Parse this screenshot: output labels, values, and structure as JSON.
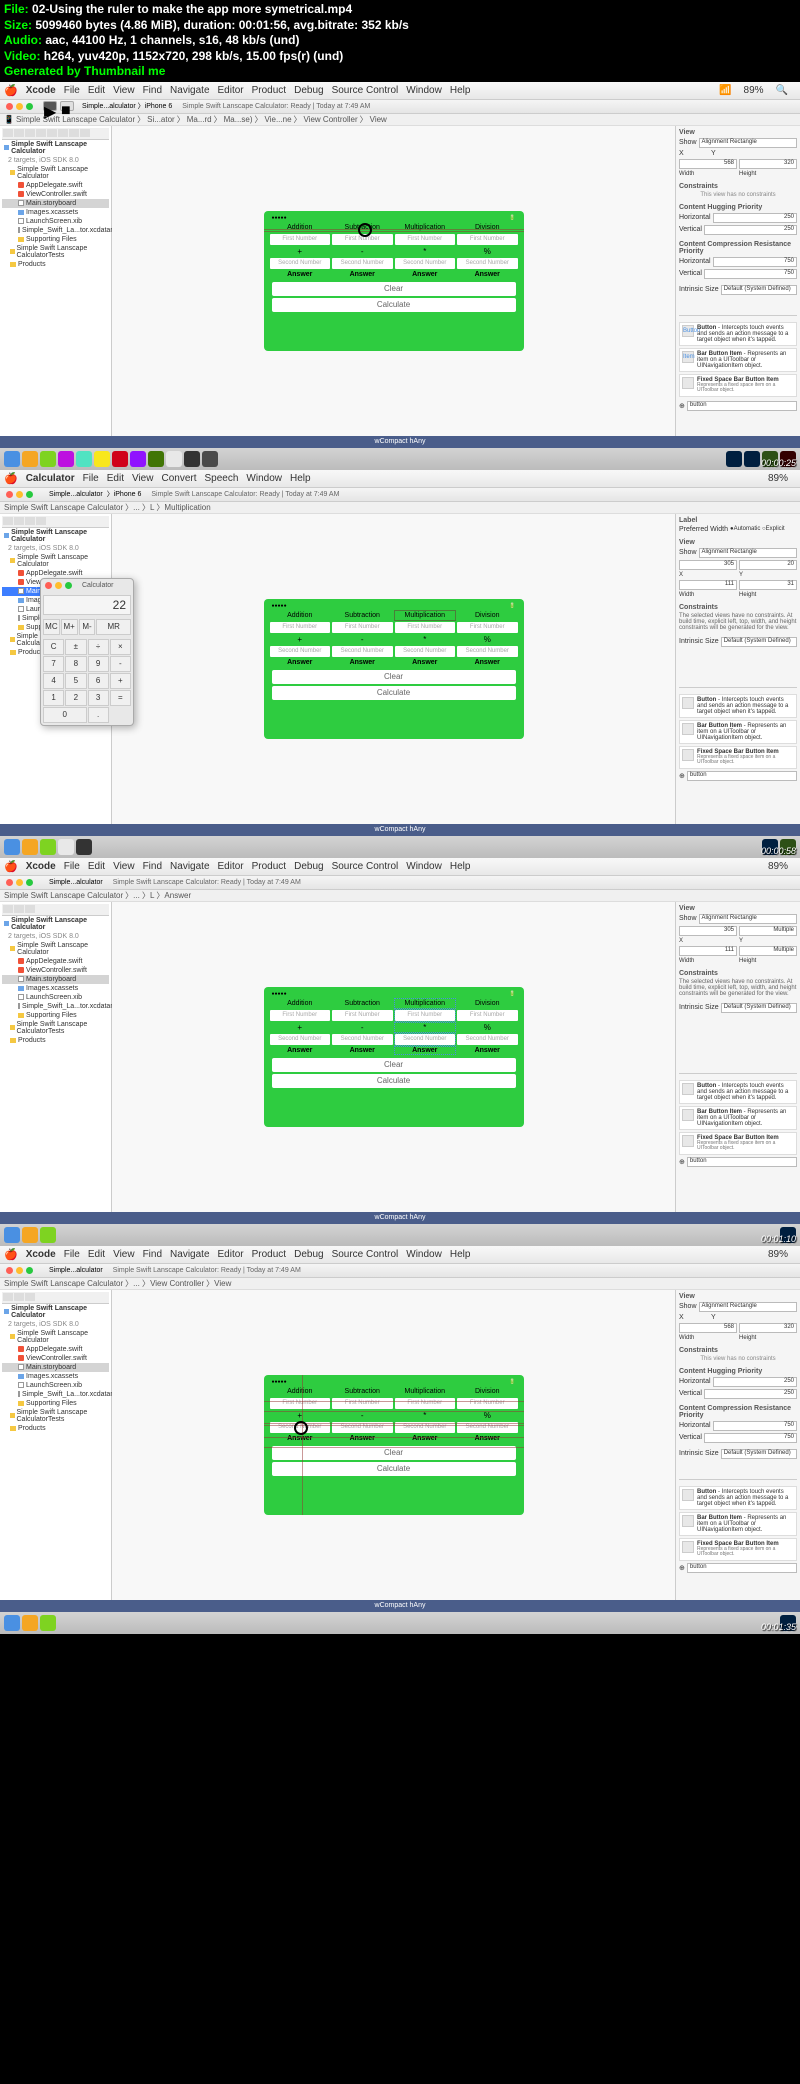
{
  "header": {
    "file": "02-Using the ruler to make the app more symetrical.mp4",
    "size": "5099460 bytes (4.86 MiB), duration: 00:01:56, avg.bitrate: 352 kb/s",
    "audio": "aac, 44100 Hz, 1 channels, s16, 48 kb/s (und)",
    "video": "h264, yuv420p, 1152x720, 298 kb/s, 15.00 fps(r) (und)",
    "gen": "Generated by Thumbnail me"
  },
  "menubar": {
    "app": "Xcode",
    "items": [
      "File",
      "Edit",
      "View",
      "Find",
      "Navigate",
      "Editor",
      "Product",
      "Debug",
      "Source Control",
      "Window",
      "Help"
    ],
    "calc_items": [
      "File",
      "Edit",
      "View",
      "Convert",
      "Speech",
      "Window",
      "Help"
    ],
    "calc_app": "Calculator",
    "battery": "89%"
  },
  "breadcrumb": {
    "scheme": "Simple...alculator",
    "device": "iPhone 6",
    "status": "Simple Swift Lanscape Calculator: Ready | Today at 7:49 AM",
    "path": [
      "Simple Swift Lanscape Calculator",
      "Si...ator",
      "Ma...rd",
      "Ma...se)",
      "Vie...ne",
      "View Controller",
      "View"
    ]
  },
  "navigator": {
    "project": "Simple Swift Lanscape Calculator",
    "targets": "2 targets, iOS SDK 8.0",
    "items": [
      "Simple Swift Lanscape Calculator",
      "AppDelegate.swift",
      "ViewController.swift",
      "Main.storyboard",
      "Images.xcassets",
      "LaunchScreen.xib",
      "Simple_Swift_La...tor.xcdatamodeld",
      "Supporting Files",
      "Simple Swift Lanscape CalculatorTests",
      "Products"
    ]
  },
  "phone": {
    "cols": [
      "Addition",
      "Subtraction",
      "Multiplication",
      "Division"
    ],
    "ph1": "First Number",
    "ops": [
      "+",
      "-",
      "*",
      "%"
    ],
    "ph2": "Second Number",
    "answer": "Answer",
    "clear": "Clear",
    "calculate": "Calculate"
  },
  "inspector": {
    "view": "View",
    "show": "Show",
    "show_val": "Alignment Rectangle",
    "x": "X",
    "y": "Y",
    "x_val1": "568",
    "y_val1": "320",
    "x_val2": "305",
    "y_val2": "20",
    "x_val3": "111",
    "y_val3": "31",
    "x_val4": "305",
    "y_val4": "Multiple",
    "x_val5": "111",
    "y_val5": "Multiple",
    "x_val6": "568",
    "y_val6": "320",
    "width": "Width",
    "height": "Height",
    "label": "Label",
    "pref_width": "Preferred Width",
    "automatic": "Automatic",
    "explicit": "Explicit",
    "constraints": "Constraints",
    "no_constraints": "This view has no constraints",
    "no_constraints_long": "The selected views have no constraints. At build time, explicit left, top, width, and height constraints will be generated for the view.",
    "chp": "Content Hugging Priority",
    "ccrp": "Content Compression Resistance Priority",
    "horizontal": "Horizontal",
    "vertical": "Vertical",
    "h250": "250",
    "v250": "250",
    "h750": "750",
    "v750": "750",
    "intrinsic": "Intrinsic Size",
    "intrinsic_val": "Default (System Defined)"
  },
  "library": {
    "button": {
      "name": "Button",
      "desc": "Intercepts touch events and sends an action message to a target object when it's tapped."
    },
    "baritem": {
      "name": "Bar Button Item",
      "desc": "Represents an item on a UIToolbar or UINavigationItem object."
    },
    "fixed": {
      "name": "Fixed Space Bar Button Item",
      "desc": "Represents a fixed space item on a UIToolbar object."
    },
    "search": "button"
  },
  "sizeclass": "wCompact hAny",
  "calculator": {
    "title": "Calculator",
    "display": "22",
    "btns": [
      "MC",
      "M+",
      "M-",
      "MR",
      "C",
      "±",
      "÷",
      "×",
      "7",
      "8",
      "9",
      "-",
      "4",
      "5",
      "6",
      "+",
      "1",
      "2",
      "3",
      "=",
      "0",
      ".",
      "="
    ]
  },
  "timestamps": [
    "00:00:25",
    "00:00:58",
    "00:01:10",
    "00:01:35"
  ]
}
